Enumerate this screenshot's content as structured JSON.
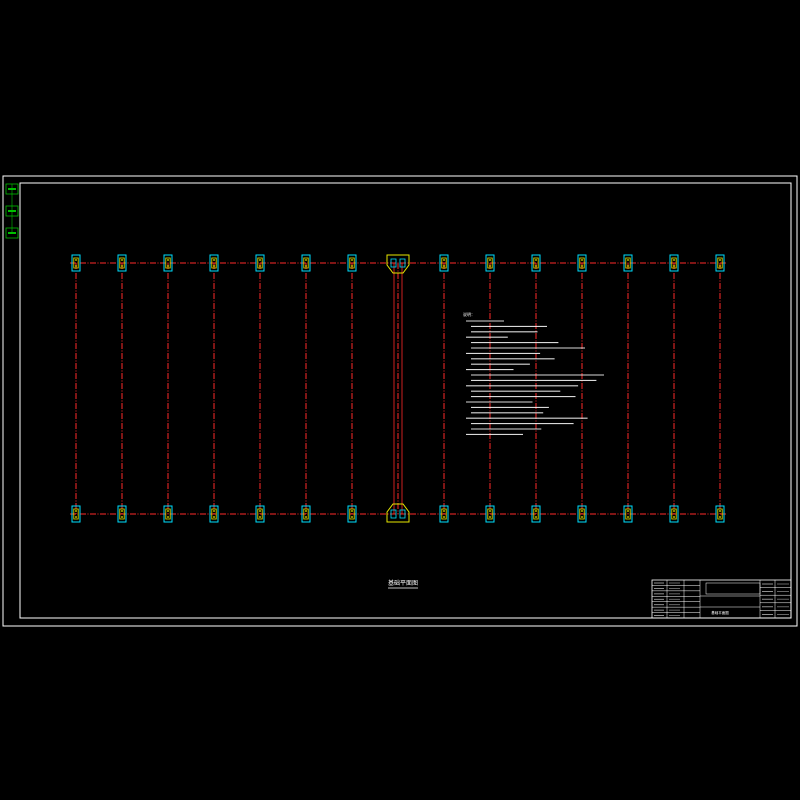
{
  "drawing": {
    "title": "基础平面图",
    "colors": {
      "background": "#000000",
      "frame": "#ffffff",
      "grid_line": "#ff2a2a",
      "foundation": "#00e0ff",
      "foundation_inner": "#e8e800",
      "notes_text": "#ffffff",
      "stamp": "#00c000",
      "title_block_text": "#ffffff"
    },
    "columns_per_row": 15,
    "rows": 2,
    "special_column_index": 7
  },
  "notes": {
    "heading": "说明：",
    "lines": [
      "",
      "",
      "",
      "",
      "",
      "",
      "",
      "",
      "",
      "",
      "",
      "",
      "",
      "",
      "",
      "",
      "",
      "",
      "",
      "",
      "",
      ""
    ]
  },
  "stamps": [
    "",
    "",
    ""
  ],
  "title_block": {
    "project": "",
    "drawing_name": "基础平面图",
    "left_rows": [
      "",
      "",
      "",
      "",
      "",
      "",
      ""
    ],
    "right_rows": [
      "",
      "",
      "",
      "",
      ""
    ]
  }
}
